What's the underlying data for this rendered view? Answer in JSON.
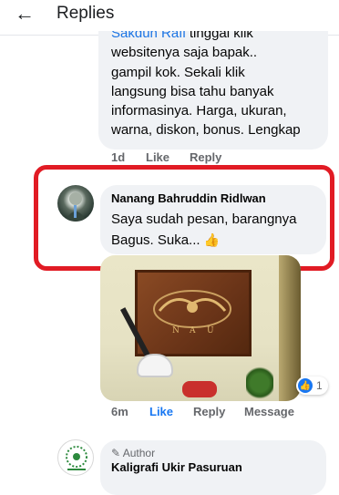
{
  "header": {
    "back_icon": "arrow-left-icon",
    "title": "Replies"
  },
  "comments": [
    {
      "mention": "Sakdun Rafi",
      "text": " tinggal klik\nwebsitenya saja bapak..\ngampil kok. Sekali klik\nlangsung bisa tahu banyak\ninformasinya. Harga, ukuran,\nwarna, diskon, bonus. Lengkap",
      "time": "1d",
      "like": "Like",
      "reply": "Reply"
    },
    {
      "author": "Nanang Bahruddin Ridlwan",
      "text": "Saya sudah pesan, barangnya Bagus. Suka... ",
      "emoji": "👍",
      "time": "6m",
      "like": "Like",
      "reply": "Reply",
      "message": "Message",
      "reaction_count": "1",
      "reaction_icon": "thumbs-up-icon"
    },
    {
      "badge_icon": "pencil-icon",
      "badge": "Author",
      "author": "Kaligrafi Ukir Pasuruan"
    }
  ],
  "colors": {
    "bubble": "#f0f2f5",
    "link": "#1b74e4",
    "highlight": "#e11b24",
    "like_active": "#1877f2",
    "meta": "#65676b"
  }
}
